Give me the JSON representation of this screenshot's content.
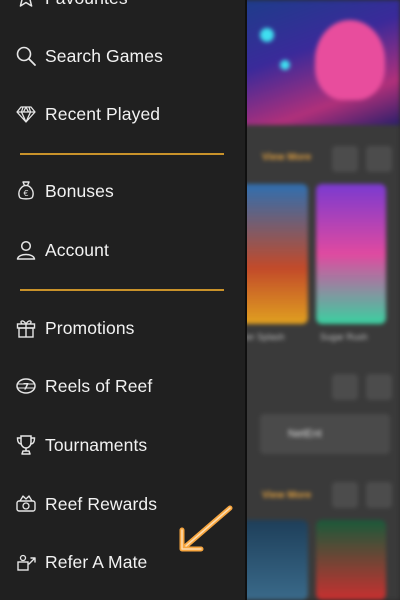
{
  "menu": {
    "items_top": [
      {
        "label": "Favourites",
        "icon": "star-icon"
      },
      {
        "label": "Search Games",
        "icon": "search-icon"
      },
      {
        "label": "Recent Played",
        "icon": "diamond-icon"
      }
    ],
    "items_mid": [
      {
        "label": "Bonuses",
        "icon": "money-bag-icon"
      },
      {
        "label": "Account",
        "icon": "user-icon"
      }
    ],
    "items_bottom": [
      {
        "label": "Promotions",
        "icon": "gift-icon"
      },
      {
        "label": "Reels of Reef",
        "icon": "slot-reel-icon"
      },
      {
        "label": "Tournaments",
        "icon": "trophy-icon"
      },
      {
        "label": "Reef Rewards",
        "icon": "rewards-icon"
      },
      {
        "label": "Refer A Mate",
        "icon": "refer-icon"
      }
    ],
    "divider_color": "#c9922a"
  },
  "background": {
    "row_label_1": "View More",
    "row_label_2": "View More",
    "tile_caption_1": "ker Splash",
    "tile_caption_2": "Sugar Rush",
    "provider_logo": "NetEnt"
  },
  "annotation": {
    "arrow_color": "#f7a640",
    "icon": "arrow-pointer-icon"
  }
}
